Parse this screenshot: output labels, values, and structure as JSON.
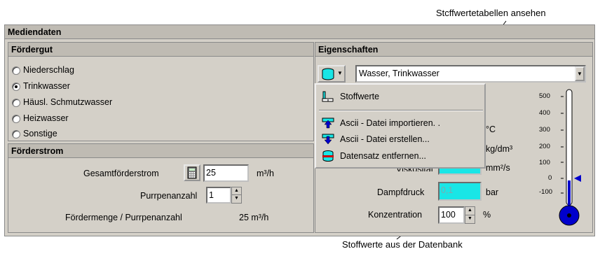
{
  "annotations": {
    "top": "Stcffwertetabellen ansehen",
    "bottom": "Stoffwerte aus der Datenbank"
  },
  "section_title": "Mediendaten",
  "foerdergut": {
    "title": "Fördergut",
    "options": [
      {
        "label": "Niederschlag",
        "selected": false
      },
      {
        "label": "Trinkwasser",
        "selected": true
      },
      {
        "label": "Häusl. Schmutzwasser",
        "selected": false
      },
      {
        "label": "Heizwasser",
        "selected": false
      },
      {
        "label": "Sonstige",
        "selected": false
      }
    ]
  },
  "foerderstrom": {
    "title": "Förderstrom",
    "gesamt_label": "Gesamtförderstrom",
    "gesamt_value": "25",
    "gesamt_unit": "m³/h",
    "pumpen_label": "Purrpenanzahl",
    "pumpen_value": "1",
    "menge_label": "Fördermenge / Purrpenanzahl",
    "menge_value": "25 m³/h"
  },
  "eigenschaften": {
    "title": "Eigenschaften",
    "medium_selected": "Wasser, Trinkwasser",
    "partial_labels": {
      "temp_unit": "°C",
      "density_unit": "kg/dm³",
      "viscosity_label": "Viskosität",
      "viscosity_unit": "mm²/s"
    },
    "dampfdruck_label": "Dampfdruck",
    "dampfdruck_value": "0,1",
    "dampfdruck_unit": "bar",
    "konzentration_label": "Konzentration",
    "konzentration_value": "100",
    "konzentration_unit": "%"
  },
  "menu": {
    "items": [
      "Stoffwerte",
      "Ascii - Datei importieren. .",
      "Ascii - Datei erstellen...",
      "Datensatz entfernen..."
    ]
  },
  "thermometer": {
    "ticks": [
      "500",
      "400",
      "300",
      "200",
      "100",
      "0",
      "-100"
    ],
    "indicator_value": 0
  },
  "colors": {
    "panel": "#d4d0c8",
    "header": "#bfbbb3",
    "cyan_field": "#19e6e6",
    "thermo_blue": "#0000cc"
  }
}
